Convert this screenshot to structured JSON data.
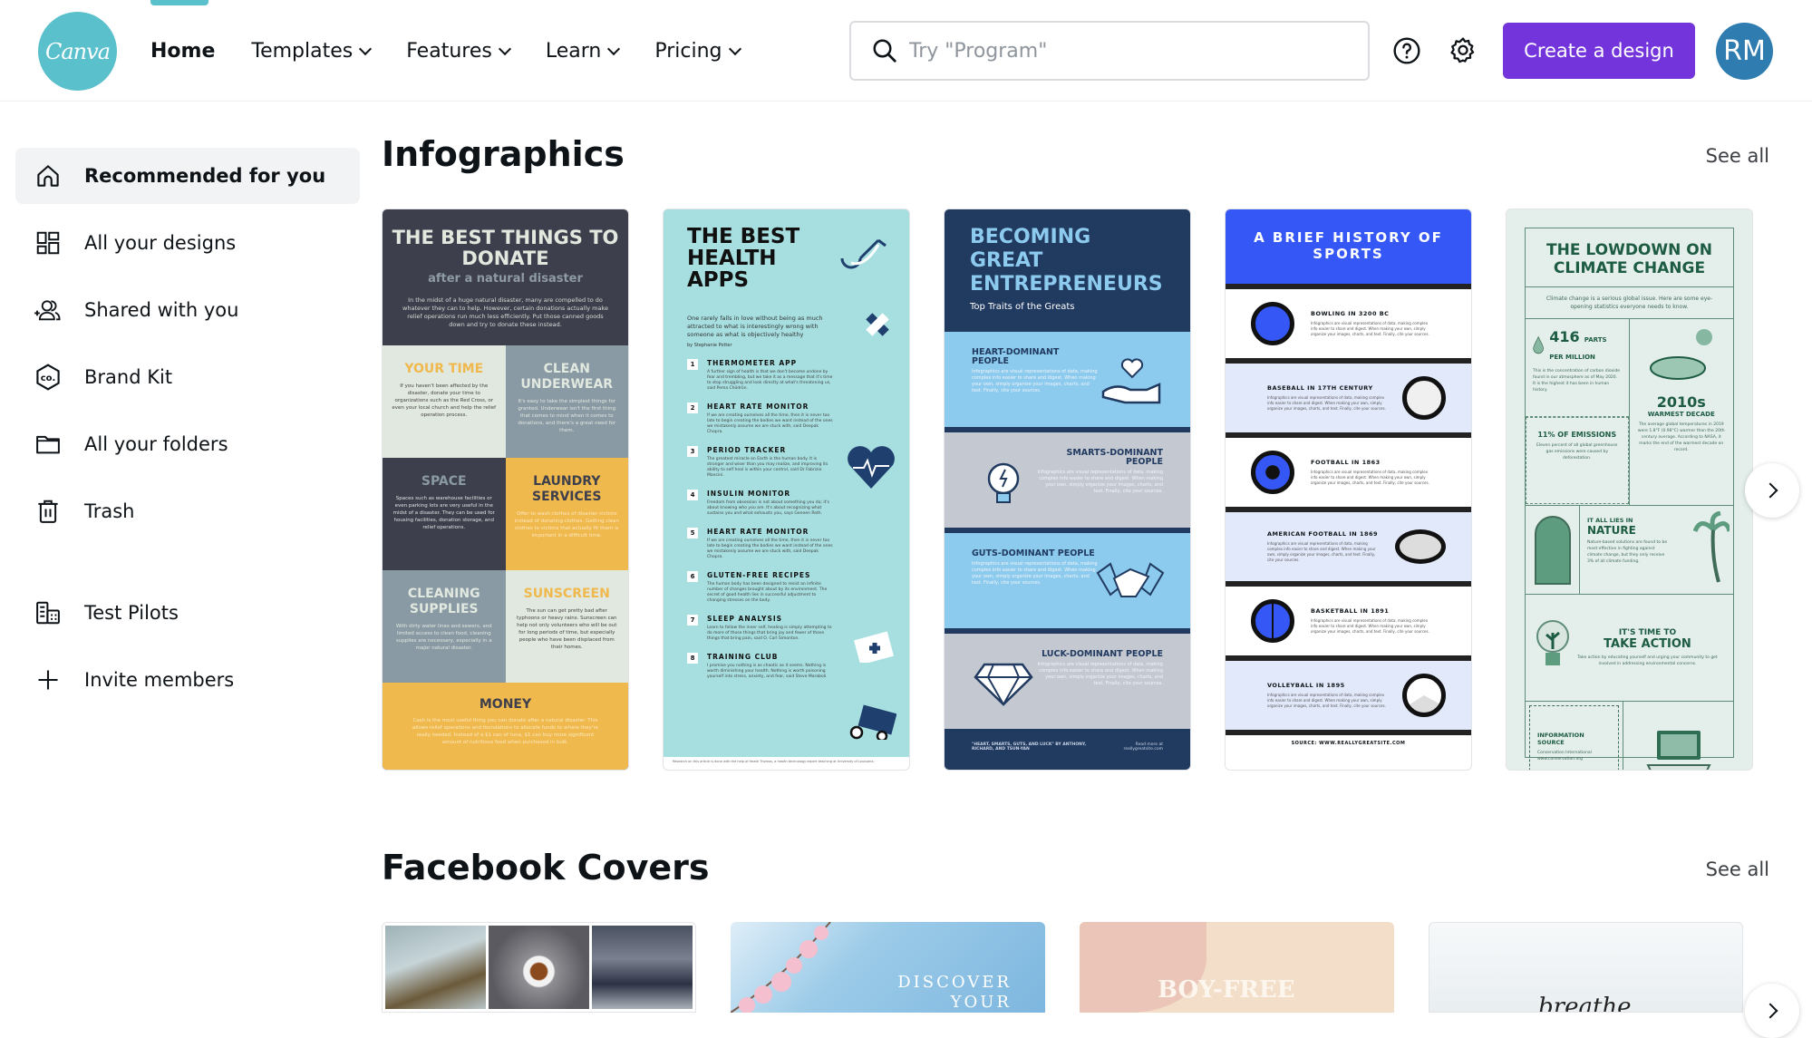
{
  "header": {
    "logo_text": "Canva",
    "nav": [
      {
        "label": "Home",
        "active": true,
        "dropdown": false
      },
      {
        "label": "Templates",
        "active": false,
        "dropdown": true
      },
      {
        "label": "Features",
        "active": false,
        "dropdown": true
      },
      {
        "label": "Learn",
        "active": false,
        "dropdown": true
      },
      {
        "label": "Pricing",
        "active": false,
        "dropdown": true
      }
    ],
    "search_placeholder": "Try \"Program\"",
    "search_value": "",
    "create_button": "Create a design",
    "avatar_initials": "RM",
    "colors": {
      "brand": "#5ac0cc",
      "accent": "#7434db",
      "avatar": "#2e7cb0"
    }
  },
  "sidebar": {
    "items": [
      {
        "label": "Recommended for you",
        "icon": "home-icon",
        "active": true
      },
      {
        "label": "All your designs",
        "icon": "grid-icon",
        "active": false
      },
      {
        "label": "Shared with you",
        "icon": "shared-users-icon",
        "active": false
      },
      {
        "label": "Brand Kit",
        "icon": "brand-kit-icon",
        "active": false
      },
      {
        "label": "All your folders",
        "icon": "folder-icon",
        "active": false
      },
      {
        "label": "Trash",
        "icon": "trash-icon",
        "active": false
      }
    ],
    "team": [
      {
        "label": "Test Pilots",
        "icon": "team-building-icon"
      },
      {
        "label": "Invite members",
        "icon": "plus-icon"
      }
    ]
  },
  "sections": {
    "infographics": {
      "title": "Infographics",
      "see_all": "See all",
      "cards": {
        "donate": {
          "title": "THE BEST THINGS TO DONATE",
          "subtitle": "after a natural disaster",
          "intro": "In the midst of a huge natural disaster, many are compelled to do whatever they can to help. However, certain donations actually make relief operations run much less efficiently. Put those canned goods down and try to donate these instead.",
          "cells": [
            {
              "heading": "YOUR TIME",
              "text": "If you haven't been affected by the disaster, donate your time to organizations such as the Red Cross, or even your local church and help the relief operation process."
            },
            {
              "heading": "CLEAN UNDERWEAR",
              "text": "It's easy to take the simplest things for granted. Underwear isn't the first thing that comes to mind when it comes to donations, and there's a great need for them."
            },
            {
              "heading": "SPACE",
              "text": "Spaces such as warehouse facilities or even parking lots are very useful in the midst of a disaster. They can be used for housing facilities, donation storage, and relief operations."
            },
            {
              "heading": "LAUNDRY SERVICES",
              "text": "Offer to wash clothes of disaster victims instead of donating clothes. Getting clean clothes to victims that actually fit them is important in a difficult time."
            },
            {
              "heading": "CLEANING SUPPLIES",
              "text": "With dirty water lines and sewers, and limited access to clean food, cleaning supplies are necessary, especially in a major natural disaster."
            },
            {
              "heading": "SUNSCREEN",
              "text": "The sun can get pretty bad after typhoons or heavy rains. Sunscreen can help not only volunteers who will be out for long periods of time, but especially people who have been displaced from their homes."
            }
          ],
          "money_heading": "MONEY",
          "money_text": "Cash is the most useful thing you can donate after a natural disaster. This allows relief operations and foundations to allocate funds to where they're really needed. Instead of a $1 can of tuna, $1 can buy more significant amount of nutritious food when purchased in bulk."
        },
        "health": {
          "title": "THE BEST HEALTH APPS",
          "lead": "One rarely falls in love without being as much attracted to what is interestingly wrong with someone as what is objectively healthy",
          "author": "by Stephanie Potter",
          "items": [
            {
              "num": "1",
              "heading": "THERMOMETER APP",
              "text": "A further sign of health is that we don't become undone by fear and trembling, but we take it as a message that it's time to stop struggling and look directly at what's threatening us, said Pema Chödrön."
            },
            {
              "num": "2",
              "heading": "HEART RATE MONITOR",
              "text": "If we are creating ourselves all the time, then it is never too late to begin creating the bodies we want instead of the ones we mistakenly assume we are stuck with, said Deepak Chopra."
            },
            {
              "num": "3",
              "heading": "PERIOD TRACKER",
              "text": "The greatest miracle on Earth is the human body. It is stronger and wiser than you may realize, and improving its ability to self heal is within your control, said Dr Fabrizio Mancini."
            },
            {
              "num": "4",
              "heading": "INSULIN MONITOR",
              "text": "Freedom from obsession is not about something you do; it's about knowing who you are. It's about recognizing what sustains you and what exhausts you, says Geneen Roth."
            },
            {
              "num": "5",
              "heading": "HEART RATE MONITOR",
              "text": "If we are creating ourselves all the time, then it is never too late to begin creating the bodies we want instead of the ones we mistakenly assume we are stuck with, said Deepak Chopra."
            },
            {
              "num": "6",
              "heading": "GLUTEN-FREE RECIPES",
              "text": "The human body has been designed to resist an infinite number of changes brought about by its environment. The secret of good health lies in successful adjustment to changing stresses on the body."
            },
            {
              "num": "7",
              "heading": "SLEEP ANALYSIS",
              "text": "Learn to follow the inner self, healing is simply attempting to do more of those things that bring joy and fewer of those things that bring pain, said O. Carl Simonton."
            },
            {
              "num": "8",
              "heading": "TRAINING CLUB",
              "text": "I promise you nothing is as chaotic as it seems. Nothing is worth diminishing your health. Nothing is worth poisoning yourself into stress, anxiety, and fear, said Steve Maraboli."
            }
          ],
          "footer": "Research on this article is done with the help of Heath Thomas, a health technology expert teaching at University of Louisiana."
        },
        "entrepreneurs": {
          "title": "BECOMING GREAT ENTREPRENEURS",
          "subtitle": "Top Traits of the Greats",
          "bands": [
            {
              "heading": "HEART-DOMINANT PEOPLE",
              "text": "Infographics are visual representations of data, making complex info easier to share and digest. When making your own, simply organize your images, charts, and text. Finally, cite your sources."
            },
            {
              "heading": "SMARTS-DOMINANT PEOPLE",
              "text": "Infographics are visual representations of data, making complex info easier to share and digest. When making your own, simply organize your images, charts, and text. Finally, cite your sources."
            },
            {
              "heading": "GUTS-DOMINANT PEOPLE",
              "text": "Infographics are visual representations of data, making complex info easier to share and digest. When making your own, simply organize your images, charts, and text. Finally, cite your sources."
            },
            {
              "heading": "LUCK-DOMINANT PEOPLE",
              "text": "Infographics are visual representations of data, making complex info easier to share and digest. When making your own, simply organize your images, charts, and text. Finally, cite your sources."
            }
          ],
          "footer_left": "\"HEART, SMARTS, GUTS, AND LUCK\" BY ANTHONY, RICHARD, AND TSUN-YAN",
          "footer_right": "Read more at reallygreatsite.com"
        },
        "sports": {
          "title": "A BRIEF HISTORY OF SPORTS",
          "rows": [
            {
              "heading": "BOWLING IN 3200 BC",
              "ball": "bowling-ball-icon"
            },
            {
              "heading": "BASEBALL IN 17TH CENTURY",
              "ball": "baseball-icon"
            },
            {
              "heading": "FOOTBALL IN 1863",
              "ball": "soccer-ball-icon"
            },
            {
              "heading": "AMERICAN FOOTBALL IN 1869",
              "ball": "american-football-icon"
            },
            {
              "heading": "BASKETBALL IN 1891",
              "ball": "basketball-icon"
            },
            {
              "heading": "VOLLEYBALL IN 1895",
              "ball": "volleyball-icon"
            }
          ],
          "row_text": "Infographics are visual representations of data, making complex info easier to share and digest. When making your own, simply organize your images, charts, and text. Finally, cite your sources.",
          "source": "SOURCE: WWW.REALLYGREATSITE.COM"
        },
        "climate": {
          "title": "THE LOWDOWN ON CLIMATE CHANGE",
          "lead": "Climate change is a serious global issue. Here are some eye-opening statistics everyone needs to know.",
          "stat1_big": "416",
          "stat1_label": "PARTS PER MILLION",
          "stat1_text": "This is the concentration of carbon dioxide found in our atmosphere as of May 2020. It is the highest it has been in human history.",
          "stat2_big": "2010s",
          "stat2_label": "WARMEST DECADE",
          "stat2_text": "The average global temperatures in 2019 were 1.8°F (0.98°C) warmer than the 20th century average. According to NASA, it marks the end of the warmest decade on record.",
          "stat3_label": "11% OF EMISSIONS",
          "stat3_text": "Eleven percent of all global greenhouse gas emissions were caused by deforestation.",
          "nature_small": "IT ALL LIES IN",
          "nature_big": "NATURE",
          "nature_text": "Nature-based solutions are found to be most effective in fighting against climate change, but they only receive 3% of all climate funding.",
          "action_small": "IT'S TIME TO",
          "action_big": "TAKE ACTION",
          "action_text": "Take action by educating yourself and urging your community to get involved in addressing environmental concerns.",
          "source_label": "INFORMATION SOURCE",
          "source_text": "Conservation International www.conservation.org"
        }
      }
    },
    "facebook_covers": {
      "title": "Facebook Covers",
      "see_all": "See all",
      "cards": [
        {
          "name": "photo-collage-cover",
          "text": ""
        },
        {
          "name": "discover-your-cover",
          "text": "DISCOVER YOUR"
        },
        {
          "name": "boy-free-cover",
          "text": "BOY-FREE"
        },
        {
          "name": "breathe-cover",
          "text": "breathe"
        }
      ]
    }
  }
}
